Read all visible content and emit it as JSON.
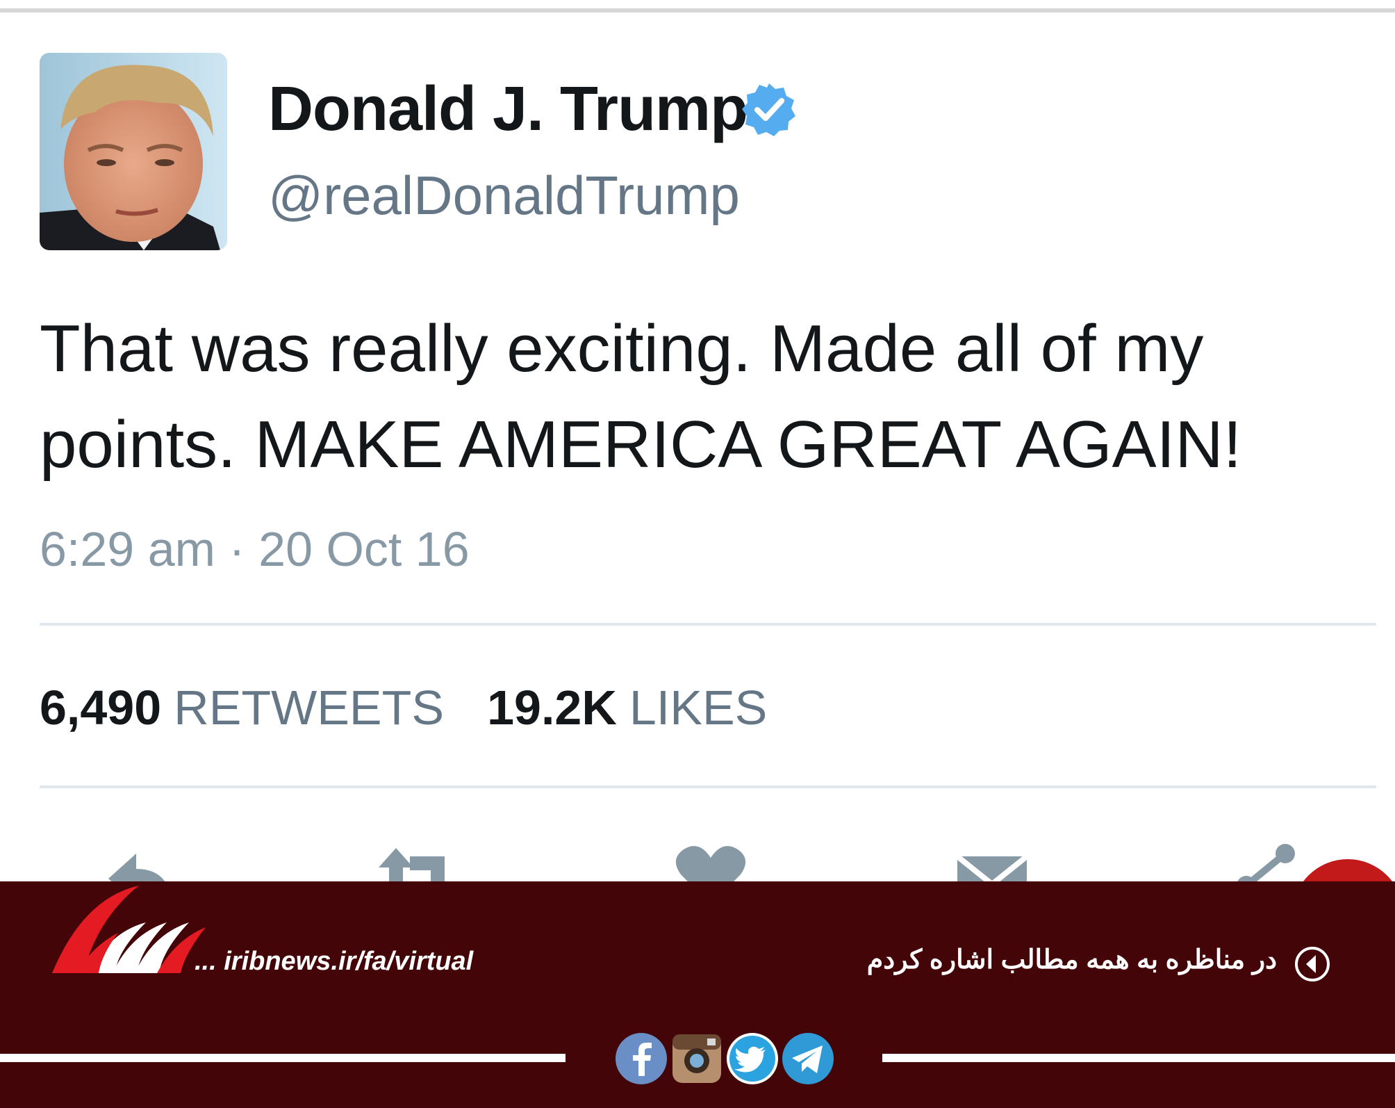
{
  "tweet": {
    "display_name": "Donald J. Trump",
    "handle": "@realDonaldTrump",
    "text": "That was really exciting. Made all of my points. MAKE AMERICA GREAT AGAIN!",
    "timestamp": "6:29 am · 20 Oct 16",
    "retweets_count": "6,490",
    "retweets_label": "RETWEETS",
    "likes_count": "19.2K",
    "likes_label": "LIKES",
    "verified_color": "#55acee"
  },
  "actions": [
    "reply-icon",
    "retweet-icon",
    "like-icon",
    "message-icon",
    "share-icon"
  ],
  "footer": {
    "background": "#430507",
    "url": "... iribnews.ir/fa/virtual",
    "headline": "در مناظره به همه مطالب اشاره کردم",
    "social": [
      "facebook-icon",
      "instagram-icon",
      "twitter-icon",
      "telegram-icon"
    ]
  }
}
